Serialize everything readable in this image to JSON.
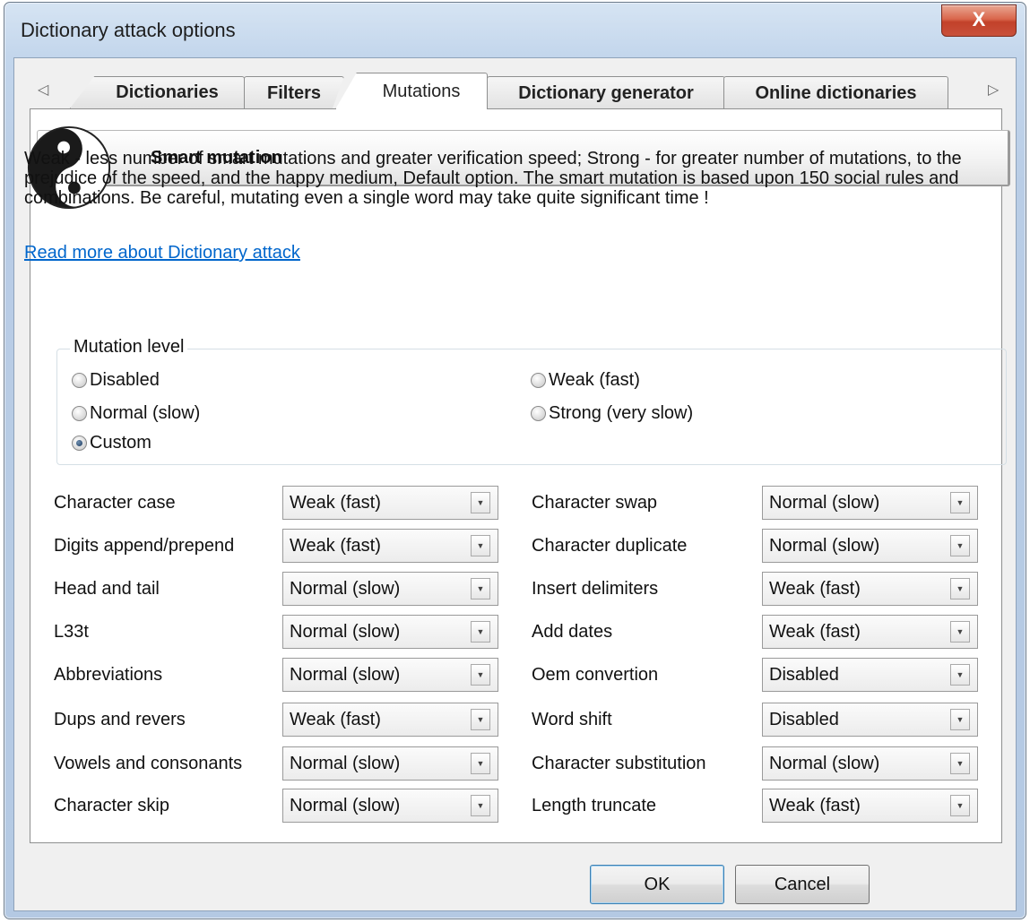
{
  "window": {
    "title": "Dictionary attack options",
    "close_label": "X"
  },
  "tabs": {
    "scroll_left": "◁",
    "scroll_right": "▷",
    "items": [
      "Dictionaries",
      "Filters",
      "Mutations",
      "Dictionary generator",
      "Online dictionaries"
    ],
    "active": "Mutations"
  },
  "banner": {
    "title": "Smart mutation",
    "icon": "yin-yang-icon"
  },
  "description": "Weak - less number of smart mutations and greater verification speed; Strong - for greater number of mutations, to the prejudice of the speed, and the happy medium, Default option. The smart mutation is based upon 150 social rules and combinations. Be careful, mutating even a single word may take quite significant time !",
  "read_more_link": "Read more about Dictionary attack",
  "mutation_level": {
    "legend": "Mutation level",
    "options": [
      "Disabled",
      "Weak (fast)",
      "Normal (slow)",
      "Strong (very slow)",
      "Custom"
    ],
    "selected": "Custom"
  },
  "settings": {
    "left": [
      {
        "label": "Character case",
        "value": "Weak (fast)"
      },
      {
        "label": "Digits append/prepend",
        "value": "Weak (fast)"
      },
      {
        "label": "Head and tail",
        "value": "Normal (slow)"
      },
      {
        "label": "L33t",
        "value": "Normal (slow)"
      },
      {
        "label": "Abbreviations",
        "value": "Normal (slow)"
      },
      {
        "label": "Dups and revers",
        "value": "Weak (fast)"
      },
      {
        "label": "Vowels and consonants",
        "value": "Normal (slow)"
      },
      {
        "label": "Character skip",
        "value": "Normal (slow)"
      }
    ],
    "right": [
      {
        "label": "Character swap",
        "value": "Normal (slow)"
      },
      {
        "label": "Character duplicate",
        "value": "Normal (slow)"
      },
      {
        "label": "Insert delimiters",
        "value": "Weak (fast)"
      },
      {
        "label": "Add dates",
        "value": "Weak (fast)"
      },
      {
        "label": "Oem convertion",
        "value": "Disabled"
      },
      {
        "label": "Word shift",
        "value": "Disabled"
      },
      {
        "label": "Character substitution",
        "value": "Normal (slow)"
      },
      {
        "label": "Length truncate",
        "value": "Weak (fast)"
      }
    ],
    "dropdown_glyph": "▼"
  },
  "buttons": {
    "ok": "OK",
    "cancel": "Cancel"
  }
}
